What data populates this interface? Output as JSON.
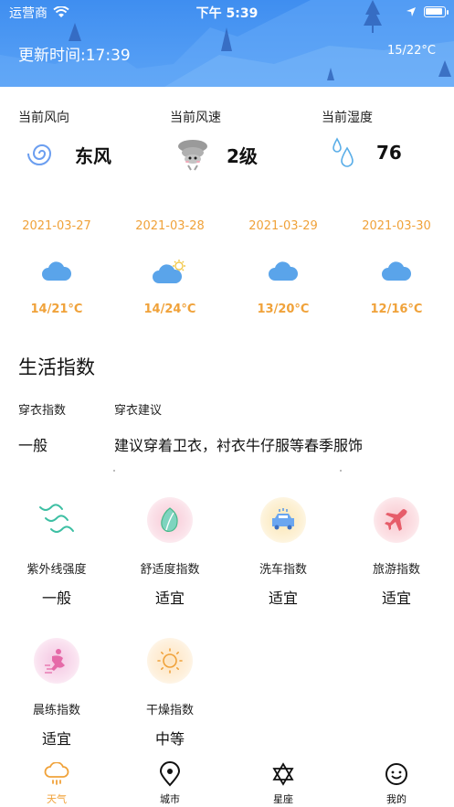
{
  "status_bar": {
    "carrier": "运营商",
    "time": "下午 5:39"
  },
  "header": {
    "update_time": "更新时间:17:39",
    "temp_range": "15/22°C"
  },
  "current": {
    "wind_dir_label": "当前风向",
    "wind_dir_value": "东风",
    "wind_speed_label": "当前风速",
    "wind_speed_value": "2级",
    "humidity_label": "当前湿度",
    "humidity_value": "76"
  },
  "forecast": [
    {
      "date": "2021-03-27",
      "temp": "14/21°C",
      "icon": "cloud-icon"
    },
    {
      "date": "2021-03-28",
      "temp": "14/24°C",
      "icon": "partly-sunny-icon"
    },
    {
      "date": "2021-03-29",
      "temp": "13/20°C",
      "icon": "cloud-icon"
    },
    {
      "date": "2021-03-30",
      "temp": "12/16°C",
      "icon": "cloud-icon"
    }
  ],
  "life": {
    "title": "生活指数",
    "dress_label": "穿衣指数",
    "dress_advice_label": "穿衣建议",
    "dress_value": "一般",
    "dress_advice": "建议穿着卫衣，衬衣牛仔服等春季服饰",
    "indices": [
      {
        "name": "紫外线强度",
        "value": "一般",
        "icon": "uv-wave-icon",
        "color": "#3dbfa3"
      },
      {
        "name": "舒适度指数",
        "value": "适宜",
        "icon": "leaf-icon",
        "color": "#48b98a"
      },
      {
        "name": "洗车指数",
        "value": "适宜",
        "icon": "car-icon",
        "color": "#4a8ee8"
      },
      {
        "name": "旅游指数",
        "value": "适宜",
        "icon": "airplane-icon",
        "color": "#e65d6a"
      },
      {
        "name": "晨练指数",
        "value": "适宜",
        "icon": "exercise-icon",
        "color": "#e56aa8"
      },
      {
        "name": "干燥指数",
        "value": "中等",
        "icon": "sun-icon",
        "color": "#f0a23a"
      }
    ]
  },
  "tabs": [
    {
      "label": "天气",
      "icon": "cloud-rain-icon",
      "active": true
    },
    {
      "label": "城市",
      "icon": "location-pin-icon",
      "active": false
    },
    {
      "label": "星座",
      "icon": "star-of-david-icon",
      "active": false
    },
    {
      "label": "我的",
      "icon": "smiley-icon",
      "active": false
    }
  ],
  "colors": {
    "accent": "#f0a23a",
    "header_blue": "#4a96f2"
  }
}
